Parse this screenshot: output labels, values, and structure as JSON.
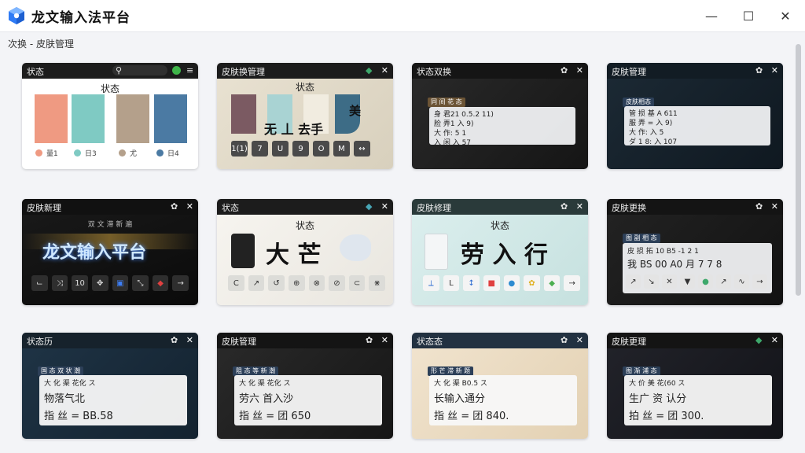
{
  "window": {
    "title": "龙文输入法平台",
    "minimize_icon": "—",
    "maximize_icon": "☐",
    "close_icon": "✕",
    "accent": "#2f7bf5"
  },
  "breadcrumb": "次换 - 皮肤管理",
  "cards": {
    "c1": {
      "title": "状态",
      "subtitle": "状态",
      "swatches": [
        "#ef9a82",
        "#7fcac3",
        "#b4a08b",
        "#4b7aa3"
      ],
      "labels": [
        "量1",
        "日3",
        "尤",
        "日4"
      ]
    },
    "c2": {
      "title": "皮肤换管理",
      "subtitle": "状态",
      "chars": "无 丄  去手",
      "side_char": "美",
      "keys": [
        "1(1)",
        "7",
        "U",
        "9",
        "O",
        "M",
        "↔"
      ]
    },
    "c3": {
      "title": "状态双换",
      "tag": "同 间 花 态",
      "rows": [
        "身 君21   0.5.2 11)",
        "脸 弄1    入  9)",
        "大 作:    5 1",
        "入 闲      入  57"
      ]
    },
    "c4": {
      "title": "皮肤管理",
      "tag": "皮肤相态",
      "rows": [
        "管 损 基       A 611",
        "服 弄 =    入  9)",
        "大 作:     入  5",
        "ダ 1 8:    入 107"
      ]
    },
    "c5": {
      "title": "皮肤新理",
      "subtitle": "双 文 滞 新 遍",
      "banner": "龙文输入平台",
      "keys": [
        "⌙",
        "⤨",
        "10",
        "✥",
        "▣",
        "⤡",
        "◆",
        "→"
      ]
    },
    "c6": {
      "title": "状态",
      "subtitle": "状态",
      "chars": "大  芒",
      "keys": [
        "C",
        "↗",
        "↺",
        "⊕",
        "⊗",
        "⊘",
        "⊂",
        "⋇"
      ]
    },
    "c7": {
      "title": "皮肤修理",
      "subtitle": "状态",
      "chars": "劳  入  行",
      "keys": [
        "⟂",
        "L",
        "↕",
        "■",
        "●",
        "✿",
        "◆",
        "→"
      ]
    },
    "c8": {
      "title": "皮肤更换",
      "tag": "图 副 相 态",
      "row1": "皮 损 拓    10  B5  -1  2  1",
      "row2": "我 BS 00  A0  月  7  7  8",
      "keys": [
        "↗",
        "↘",
        "✕",
        "▼",
        "●",
        "↗",
        "∿",
        "→"
      ]
    },
    "c9": {
      "title": "状态历",
      "tag": "国 态 双 状 潮",
      "line1": "大 化 渠    花化 ス",
      "line2": "物落气北",
      "line3": "指 丝 =  BB.58"
    },
    "c10": {
      "title": "皮肤管理",
      "tag": "阻 态 等 新 潮",
      "line1": "大 化 渠    花化 ス",
      "line2": "劳六 首入沙",
      "line3": "指 丝 =  团 650"
    },
    "c11": {
      "title": "状态态",
      "tag": "形 芒 滞 新 题",
      "line1": "大 化 渠    B0.5 ス",
      "line2": "长输入通分",
      "line3": "指 丝 =  团 840."
    },
    "c12": {
      "title": "皮肤更理",
      "tag": "图 渐 浦 态",
      "line1": "大 价 美    花(60 ス",
      "line2": "生广 资 认分",
      "line3": "拍 丝 =  团 300."
    }
  }
}
